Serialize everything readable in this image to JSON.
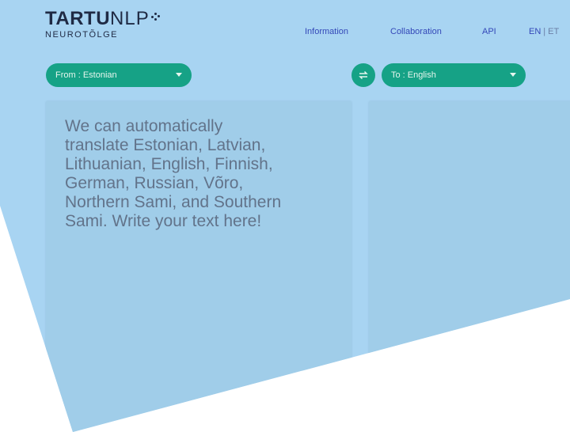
{
  "logo": {
    "brand_bold": "TARTU",
    "brand_light": "NLP",
    "subtitle": "NEUROTÕLGE"
  },
  "nav": {
    "items": [
      {
        "label": "Information"
      },
      {
        "label": "Collaboration"
      },
      {
        "label": "API"
      }
    ],
    "language": {
      "en": "EN",
      "separator": "|",
      "et": "ET"
    }
  },
  "translator": {
    "from_label": "From : Estonian",
    "to_label": "To : English",
    "source_placeholder": "We can automatically\ntranslate Estonian, Latvian,\nLithuanian, English, Finnish,\nGerman, Russian, Võro,\nNorthern Sami, and Southern\nSami. Write your text here!",
    "target_text": ""
  },
  "colors": {
    "background": "#a8d4f2",
    "accent": "#16a286",
    "nav_link": "#3448b8",
    "placeholder_text": "#62738a"
  },
  "icons": {
    "swap": "swap-arrows-icon",
    "dropdown": "chevron-down-icon"
  }
}
